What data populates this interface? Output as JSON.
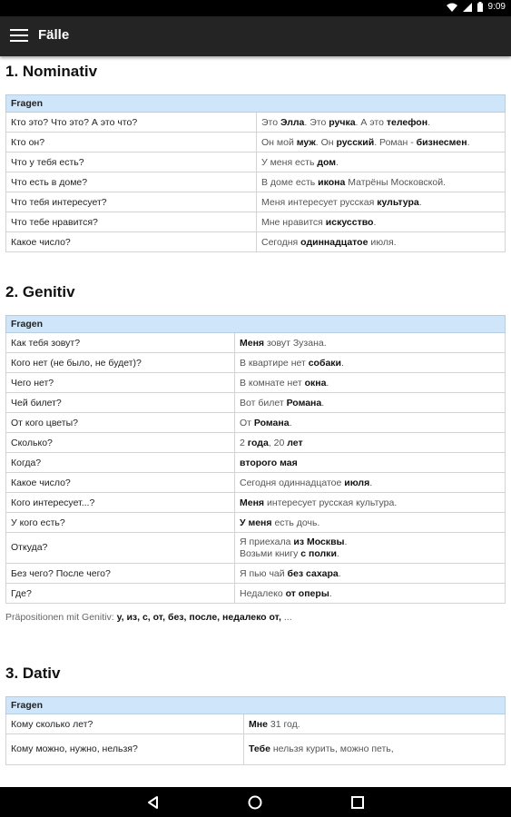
{
  "status": {
    "time": "9:09"
  },
  "app_bar": {
    "title": "Fälle"
  },
  "sections": {
    "nominativ": {
      "title": "1. Nominativ",
      "header": "Fragen",
      "rows": [
        {
          "q": "Кто это? Что это? А это что?",
          "a": [
            [
              "Это ",
              0
            ],
            [
              "Элла",
              1
            ],
            [
              ". Это ",
              0
            ],
            [
              "ручка",
              1
            ],
            [
              ". А это ",
              0
            ],
            [
              "телефон",
              1
            ],
            [
              ".",
              0
            ]
          ]
        },
        {
          "q": "Кто он?",
          "a": [
            [
              "Он мой ",
              0
            ],
            [
              "муж",
              1
            ],
            [
              ". Он ",
              0
            ],
            [
              "русский",
              1
            ],
            [
              ". Роман - ",
              0
            ],
            [
              "бизнесмен",
              1
            ],
            [
              ".",
              0
            ]
          ]
        },
        {
          "q": "Что у тебя есть?",
          "a": [
            [
              "У меня есть ",
              0
            ],
            [
              "дом",
              1
            ],
            [
              ".",
              0
            ]
          ]
        },
        {
          "q": "Что есть в доме?",
          "a": [
            [
              "В доме есть ",
              0
            ],
            [
              "икона",
              1
            ],
            [
              " Матрёны Московской.",
              0
            ]
          ]
        },
        {
          "q": "Что тебя интересует?",
          "a": [
            [
              "Меня интересует русская ",
              0
            ],
            [
              "культура",
              1
            ],
            [
              ".",
              0
            ]
          ]
        },
        {
          "q": "Что тебе нравится?",
          "a": [
            [
              "Мне нравится ",
              0
            ],
            [
              "искусство",
              1
            ],
            [
              ".",
              0
            ]
          ]
        },
        {
          "q": "Какое число?",
          "a": [
            [
              "Сегодня ",
              0
            ],
            [
              "одиннадцатое",
              1
            ],
            [
              " июля.",
              0
            ]
          ]
        }
      ]
    },
    "genitiv": {
      "title": "2. Genitiv",
      "header": "Fragen",
      "rows": [
        {
          "q": "Как тебя зовут?",
          "a": [
            [
              "Меня",
              1
            ],
            [
              " зовут Зузана.",
              0
            ]
          ]
        },
        {
          "q": "Кого нет (не было, не будет)?",
          "a": [
            [
              "В квартире нет ",
              0
            ],
            [
              "собаки",
              1
            ],
            [
              ".",
              0
            ]
          ]
        },
        {
          "q": "Чего нет?",
          "a": [
            [
              "В комнате нет ",
              0
            ],
            [
              "окна",
              1
            ],
            [
              ".",
              0
            ]
          ]
        },
        {
          "q": "Чей билет?",
          "a": [
            [
              "Вот билет ",
              0
            ],
            [
              "Романа",
              1
            ],
            [
              ".",
              0
            ]
          ]
        },
        {
          "q": "От кого цветы?",
          "a": [
            [
              "От ",
              0
            ],
            [
              "Романа",
              1
            ],
            [
              ".",
              0
            ]
          ]
        },
        {
          "q": "Сколько?",
          "a": [
            [
              "2 ",
              0
            ],
            [
              "года",
              1
            ],
            [
              ", 20 ",
              0
            ],
            [
              "лет",
              1
            ]
          ]
        },
        {
          "q": "Когда?",
          "a": [
            [
              "второго мая",
              1
            ]
          ]
        },
        {
          "q": "Какое число?",
          "a": [
            [
              "Сегодня одиннадцатое ",
              0
            ],
            [
              "июля",
              1
            ],
            [
              ".",
              0
            ]
          ]
        },
        {
          "q": "Кого интересует...?",
          "a": [
            [
              "Меня",
              1
            ],
            [
              " интересует русская культура.",
              0
            ]
          ]
        },
        {
          "q": "У кого есть?",
          "a": [
            [
              "У меня",
              1
            ],
            [
              " есть дочь.",
              0
            ]
          ]
        },
        {
          "q": "Откуда?",
          "tall": true,
          "a": [
            [
              "Я приехала ",
              0
            ],
            [
              "из Москвы",
              1
            ],
            [
              ".",
              0
            ],
            [
              "\n",
              0
            ],
            [
              "Возьми книгу ",
              0
            ],
            [
              "с полки",
              1
            ],
            [
              ".",
              0
            ]
          ]
        },
        {
          "q": "Без чего? После чего?",
          "a": [
            [
              "Я пью чай ",
              0
            ],
            [
              "без сахара",
              1
            ],
            [
              ".",
              0
            ]
          ]
        },
        {
          "q": "Где?",
          "a": [
            [
              "Недалеко ",
              0
            ],
            [
              "от оперы",
              1
            ],
            [
              ".",
              0
            ]
          ]
        }
      ],
      "prepositions_label": "Präpositionen mit Genitiv: ",
      "prepositions": "у, из, с, от, без, после, недалеко от,",
      "prepositions_tail": " ..."
    },
    "dativ": {
      "title": "3. Dativ",
      "header": "Fragen",
      "rows": [
        {
          "q": "Кому сколько лет?",
          "a": [
            [
              "Мне",
              1
            ],
            [
              " 31 год.",
              0
            ]
          ]
        },
        {
          "q": "Кому можно, нужно, нельзя?",
          "tall": true,
          "a": [
            [
              "Тебе",
              1
            ],
            [
              " нельзя курить, можно петь,",
              0
            ]
          ]
        }
      ]
    }
  }
}
